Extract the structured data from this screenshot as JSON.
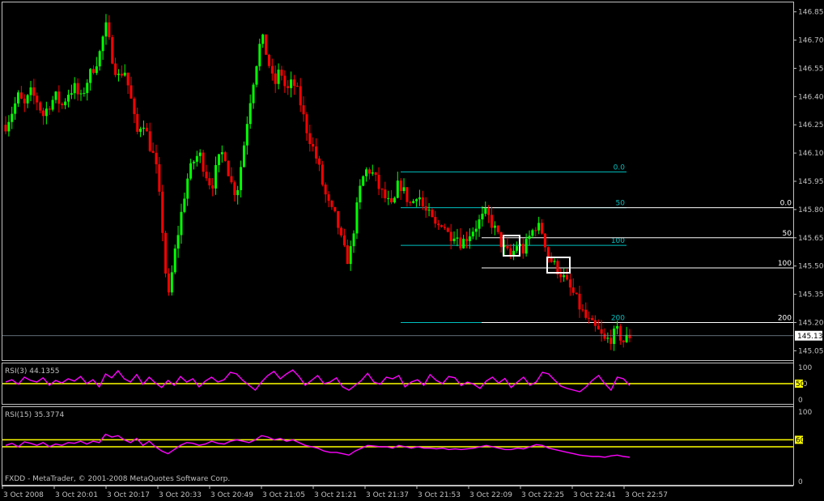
{
  "chart_data": [
    {
      "type": "candlestick",
      "panel": "main",
      "y_axis_ticks": [
        "146.85",
        "146.70",
        "146.55",
        "146.40",
        "146.25",
        "146.10",
        "145.95",
        "145.80",
        "145.65",
        "145.50",
        "145.35",
        "145.20",
        "145.05"
      ],
      "ylim": [
        145.0,
        146.9
      ],
      "current_price": "145.13",
      "current_value": 145.13,
      "x_axis_ticks": [
        "3 Oct 2008",
        "3 Oct 20:01",
        "3 Oct 20:17",
        "3 Oct 20:33",
        "3 Oct 20:49",
        "3 Oct 21:05",
        "3 Oct 21:21",
        "3 Oct 21:37",
        "3 Oct 21:53",
        "3 Oct 22:09",
        "3 Oct 22:25",
        "3 Oct 22:41",
        "3 Oct 22:57"
      ],
      "fib_set_1": [
        {
          "label": "0.0",
          "value": 146.0
        },
        {
          "label": "50",
          "value": 145.81
        },
        {
          "label": "100",
          "value": 145.61
        },
        {
          "label": "200",
          "value": 145.2
        }
      ],
      "fib_set_2": [
        {
          "label": "0.0",
          "value": 145.81
        },
        {
          "label": "50",
          "value": 145.65
        },
        {
          "label": "100",
          "value": 145.49
        },
        {
          "label": "200",
          "value": 145.2
        }
      ],
      "close_path": [
        146.25,
        146.32,
        146.4,
        146.35,
        146.42,
        146.38,
        146.3,
        146.36,
        146.4,
        146.35,
        146.42,
        146.45,
        146.38,
        146.48,
        146.55,
        146.62,
        146.78,
        146.62,
        146.5,
        146.55,
        146.4,
        146.2,
        146.28,
        146.15,
        146.05,
        145.75,
        145.3,
        145.55,
        145.75,
        145.95,
        146.05,
        146.1,
        146.0,
        145.92,
        146.05,
        146.12,
        145.95,
        145.88,
        146.1,
        146.35,
        146.55,
        146.72,
        146.6,
        146.45,
        146.55,
        146.42,
        146.48,
        146.4,
        146.25,
        146.15,
        146.05,
        145.9,
        145.8,
        145.75,
        145.6,
        145.52,
        145.75,
        145.95,
        146.02,
        145.98,
        145.9,
        145.85,
        145.8,
        145.95,
        145.88,
        145.82,
        145.9,
        145.8,
        145.76,
        145.7,
        145.74,
        145.66,
        145.68,
        145.62,
        145.66,
        145.7,
        145.74,
        145.78,
        145.72,
        145.65,
        145.58,
        145.55,
        145.62,
        145.58,
        145.66,
        145.72,
        145.68,
        145.55,
        145.5,
        145.46,
        145.4,
        145.35,
        145.28,
        145.22,
        145.18,
        145.15,
        145.1,
        145.12,
        145.15,
        145.1,
        145.13
      ]
    },
    {
      "type": "line",
      "panel": "rsi3",
      "label": "RSI(3) 44.1355",
      "y_axis_ticks": [
        "100",
        "50",
        "0"
      ],
      "level_line": 50,
      "level_label": "50",
      "ylim": [
        0,
        100
      ],
      "values": [
        55,
        62,
        48,
        70,
        60,
        55,
        68,
        45,
        60,
        52,
        65,
        58,
        72,
        50,
        62,
        40,
        80,
        68,
        90,
        65,
        55,
        78,
        48,
        70,
        52,
        38,
        60,
        45,
        72,
        55,
        65,
        40,
        58,
        70,
        55,
        62,
        85,
        80,
        60,
        45,
        30,
        55,
        75,
        88,
        65,
        80,
        92,
        72,
        45,
        60,
        75,
        50,
        55,
        68,
        40,
        30,
        45,
        60,
        82,
        55,
        48,
        70,
        65,
        75,
        40,
        55,
        62,
        45,
        78,
        60,
        50,
        72,
        68,
        44,
        55,
        48,
        35,
        58,
        70,
        52,
        66,
        38,
        55,
        70,
        45,
        55,
        85,
        80,
        60,
        42,
        35,
        30,
        25,
        40,
        60,
        75,
        50,
        30,
        70,
        65,
        44
      ]
    },
    {
      "type": "line",
      "panel": "rsi15",
      "label": "RSI(15) 35.3774",
      "y_axis_ticks": [
        "100",
        "0"
      ],
      "level_lines": [
        60,
        50
      ],
      "level_label": "60",
      "ylim": [
        0,
        100
      ],
      "values": [
        52,
        55,
        50,
        57,
        55,
        52,
        56,
        50,
        54,
        52,
        56,
        55,
        58,
        54,
        58,
        56,
        68,
        64,
        66,
        60,
        56,
        62,
        52,
        58,
        50,
        44,
        40,
        46,
        52,
        56,
        55,
        52,
        54,
        58,
        55,
        54,
        58,
        60,
        58,
        56,
        60,
        66,
        64,
        60,
        62,
        58,
        60,
        56,
        52,
        50,
        48,
        44,
        42,
        42,
        40,
        38,
        44,
        48,
        52,
        51,
        50,
        50,
        48,
        52,
        50,
        48,
        50,
        48,
        48,
        47,
        48,
        46,
        47,
        46,
        47,
        48,
        50,
        52,
        50,
        48,
        46,
        46,
        48,
        47,
        50,
        53,
        52,
        48,
        46,
        44,
        42,
        40,
        38,
        37,
        36,
        36,
        35,
        37,
        38,
        36,
        35
      ]
    }
  ],
  "footer_text": "FXDD - MetaTrader, © 2001-2008 MetaQuotes Software Corp.",
  "colors": {
    "background": "#000000",
    "bull": "#00ff00",
    "bear": "#ff0000",
    "axis": "#c0c0c0",
    "fib_set_1": "#00c0c0",
    "fib_set_2": "#ffffff",
    "rsi": "#ff00ff",
    "rsi_level": "#ffff00"
  }
}
